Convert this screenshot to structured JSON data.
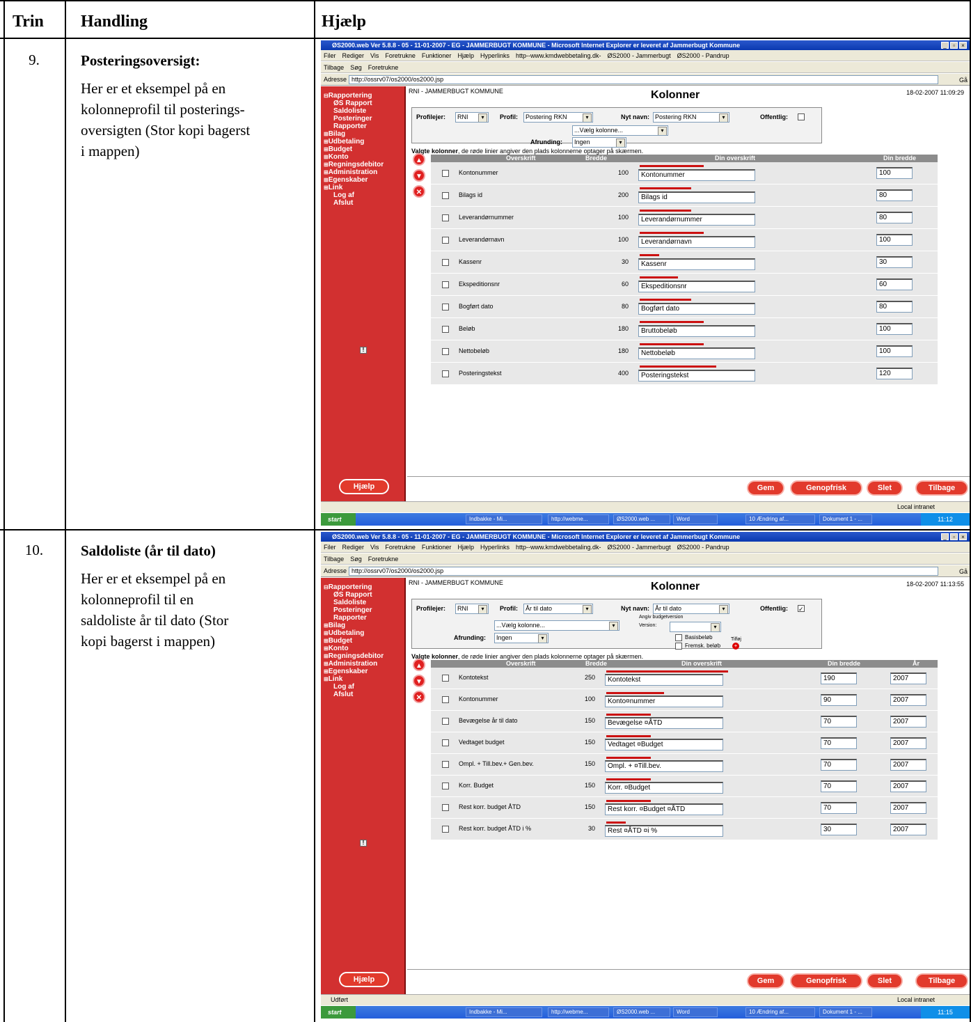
{
  "table": {
    "headers": {
      "trin": "Trin",
      "handling": "Handling",
      "hjaelp": "Hjælp"
    },
    "rows": [
      {
        "step": "9.",
        "title": "Posteringsoversigt:",
        "lines": [
          "Her er et eksempel på en",
          "kolonneprofil til posterings-",
          "oversigten (Stor kopi bagerst",
          "i mappen)"
        ]
      },
      {
        "step": "10.",
        "title": "Saldoliste (år til dato)",
        "lines": [
          "Her er et eksempel på en",
          "kolonneprofil til en",
          "saldoliste år til dato (Stor",
          "kopi bagerst i mappen)"
        ]
      }
    ]
  },
  "browser": {
    "title": "ØS2000.web Ver 5.8.8 - 05 - 11-01-2007 - EG - JAMMERBUGT KOMMUNE - Microsoft Internet Explorer er leveret af Jammerbugt Kommune",
    "menu": [
      "Filer",
      "Rediger",
      "Vis",
      "Foretrukne",
      "Funktioner",
      "Hjælp",
      "Hyperlinks",
      "http--www.kmdwebbetaling.dk-",
      "ØS2000 - Jammerbugt",
      "ØS2000 - Pandrup"
    ],
    "toolbar": [
      "Tilbage",
      "Søg",
      "Foretrukne"
    ],
    "address_label": "Adresse",
    "address": "http://ossrv07/os2000/os2000.jsp",
    "go": "Gå",
    "local_intranet": "Local intranet",
    "status2": "Udført",
    "start": "start",
    "taskbar": [
      "Indbakke - Mi...",
      "http://webme...",
      "ØS2000.web ...",
      "Word",
      "10 Ændring af...",
      "Dokument 1 - ..."
    ],
    "clock1": "11:12",
    "clock2": "11:15"
  },
  "sidebar": {
    "items": [
      "Rapportering",
      "ØS Rapport",
      "Saldoliste",
      "Posteringer",
      "Rapporter",
      "Bilag",
      "Udbetaling",
      "Budget",
      "Konto",
      "Regningsdebitor",
      "Administration",
      "Egenskaber",
      "Link",
      "Log af",
      "Afslut"
    ],
    "help": "Hjælp"
  },
  "app": {
    "org": "RNI  -  JAMMERBUGT KOMMUNE",
    "heading": "Kolonner",
    "profilejer_label": "Profilejer:",
    "profilejer": "RNI",
    "profil_label": "Profil:",
    "nyt_navn_label": "Nyt navn:",
    "offentlig_label": "Offentlig:",
    "vaelg": "...Vælg kolonne...",
    "afrunding_label": "Afrunding:",
    "afrunding": "Ingen",
    "valgte_bold": "Valgte kolonner",
    "valgte_rest": ", de røde linier angiver den plads kolonnerne optager på skærmen.",
    "col_overskrift": "Overskrift",
    "col_bredde": "Bredde",
    "col_din_overskrift": "Din overskrift",
    "col_din_bredde": "Din bredde",
    "col_aar": "År",
    "buttons": {
      "gem": "Gem",
      "genopfrisk": "Genopfrisk",
      "slet": "Slet",
      "tilbage": "Tilbage"
    },
    "budget_version_label": "Angiv budgetversion",
    "version_label": "Version:",
    "basisbeloeb": "Basisbeløb",
    "fremsk": "Fremsk. beløb",
    "tilfoej": "Tilføj"
  },
  "shot1": {
    "time": "18-02-2007 11:09:29",
    "profil": "Postering RKN",
    "nyt_navn": "Postering RKN",
    "rows": [
      {
        "name": "Kontonummer",
        "bredde": "100",
        "din": "Kontonummer",
        "din_bredde": "100",
        "red": 0.4
      },
      {
        "name": "Bilags id",
        "bredde": "200",
        "din": "Bilags id",
        "din_bredde": "80",
        "red": 0.32
      },
      {
        "name": "Leverandørnummer",
        "bredde": "100",
        "din": "Leverandørnummer",
        "din_bredde": "80",
        "red": 0.32
      },
      {
        "name": "Leverandørnavn",
        "bredde": "100",
        "din": "Leverandørnavn",
        "din_bredde": "100",
        "red": 0.4
      },
      {
        "name": "Kassenr",
        "bredde": "30",
        "din": "Kassenr",
        "din_bredde": "30",
        "red": 0.12
      },
      {
        "name": "Ekspeditionsnr",
        "bredde": "60",
        "din": "Ekspeditionsnr",
        "din_bredde": "60",
        "red": 0.24
      },
      {
        "name": "Bogført dato",
        "bredde": "80",
        "din": "Bogført dato",
        "din_bredde": "80",
        "red": 0.32
      },
      {
        "name": "Beløb",
        "bredde": "180",
        "din": "Bruttobeløb",
        "din_bredde": "100",
        "red": 0.4
      },
      {
        "name": "Nettobeløb",
        "bredde": "180",
        "din": "Nettobeløb",
        "din_bredde": "100",
        "red": 0.4
      },
      {
        "name": "Posteringstekst",
        "bredde": "400",
        "din": "Posteringstekst",
        "din_bredde": "120",
        "red": 0.48
      }
    ]
  },
  "shot2": {
    "time": "18-02-2007 11:13:55",
    "profil": "År til dato",
    "nyt_navn": "År til dato",
    "rows": [
      {
        "name": "Kontotekst",
        "bredde": "250",
        "din": "Kontotekst",
        "din_bredde": "190",
        "aar": "2007",
        "red": 0.76
      },
      {
        "name": "Kontonummer",
        "bredde": "100",
        "din": "Konto¤nummer",
        "din_bredde": "90",
        "aar": "2007",
        "red": 0.36
      },
      {
        "name": "Bevægelse år til dato",
        "bredde": "150",
        "din": "Bevægelse ¤ÅTD",
        "din_bredde": "70",
        "aar": "2007",
        "red": 0.28
      },
      {
        "name": "Vedtaget budget",
        "bredde": "150",
        "din": "Vedtaget ¤Budget",
        "din_bredde": "70",
        "aar": "2007",
        "red": 0.28
      },
      {
        "name": "Ompl. + Till.bev.+ Gen.bev.",
        "bredde": "150",
        "din": "Ompl. + ¤Till.bev.",
        "din_bredde": "70",
        "aar": "2007",
        "red": 0.28
      },
      {
        "name": "Korr. Budget",
        "bredde": "150",
        "din": "Korr. ¤Budget",
        "din_bredde": "70",
        "aar": "2007",
        "red": 0.28
      },
      {
        "name": "Rest korr. budget ÅTD",
        "bredde": "150",
        "din": "Rest korr. ¤Budget ¤ÅTD",
        "din_bredde": "70",
        "aar": "2007",
        "red": 0.28
      },
      {
        "name": "Rest korr. budget ÅTD i %",
        "bredde": "30",
        "din": "Rest  ¤ÅTD ¤i %",
        "din_bredde": "30",
        "aar": "2007",
        "red": 0.12
      }
    ]
  }
}
